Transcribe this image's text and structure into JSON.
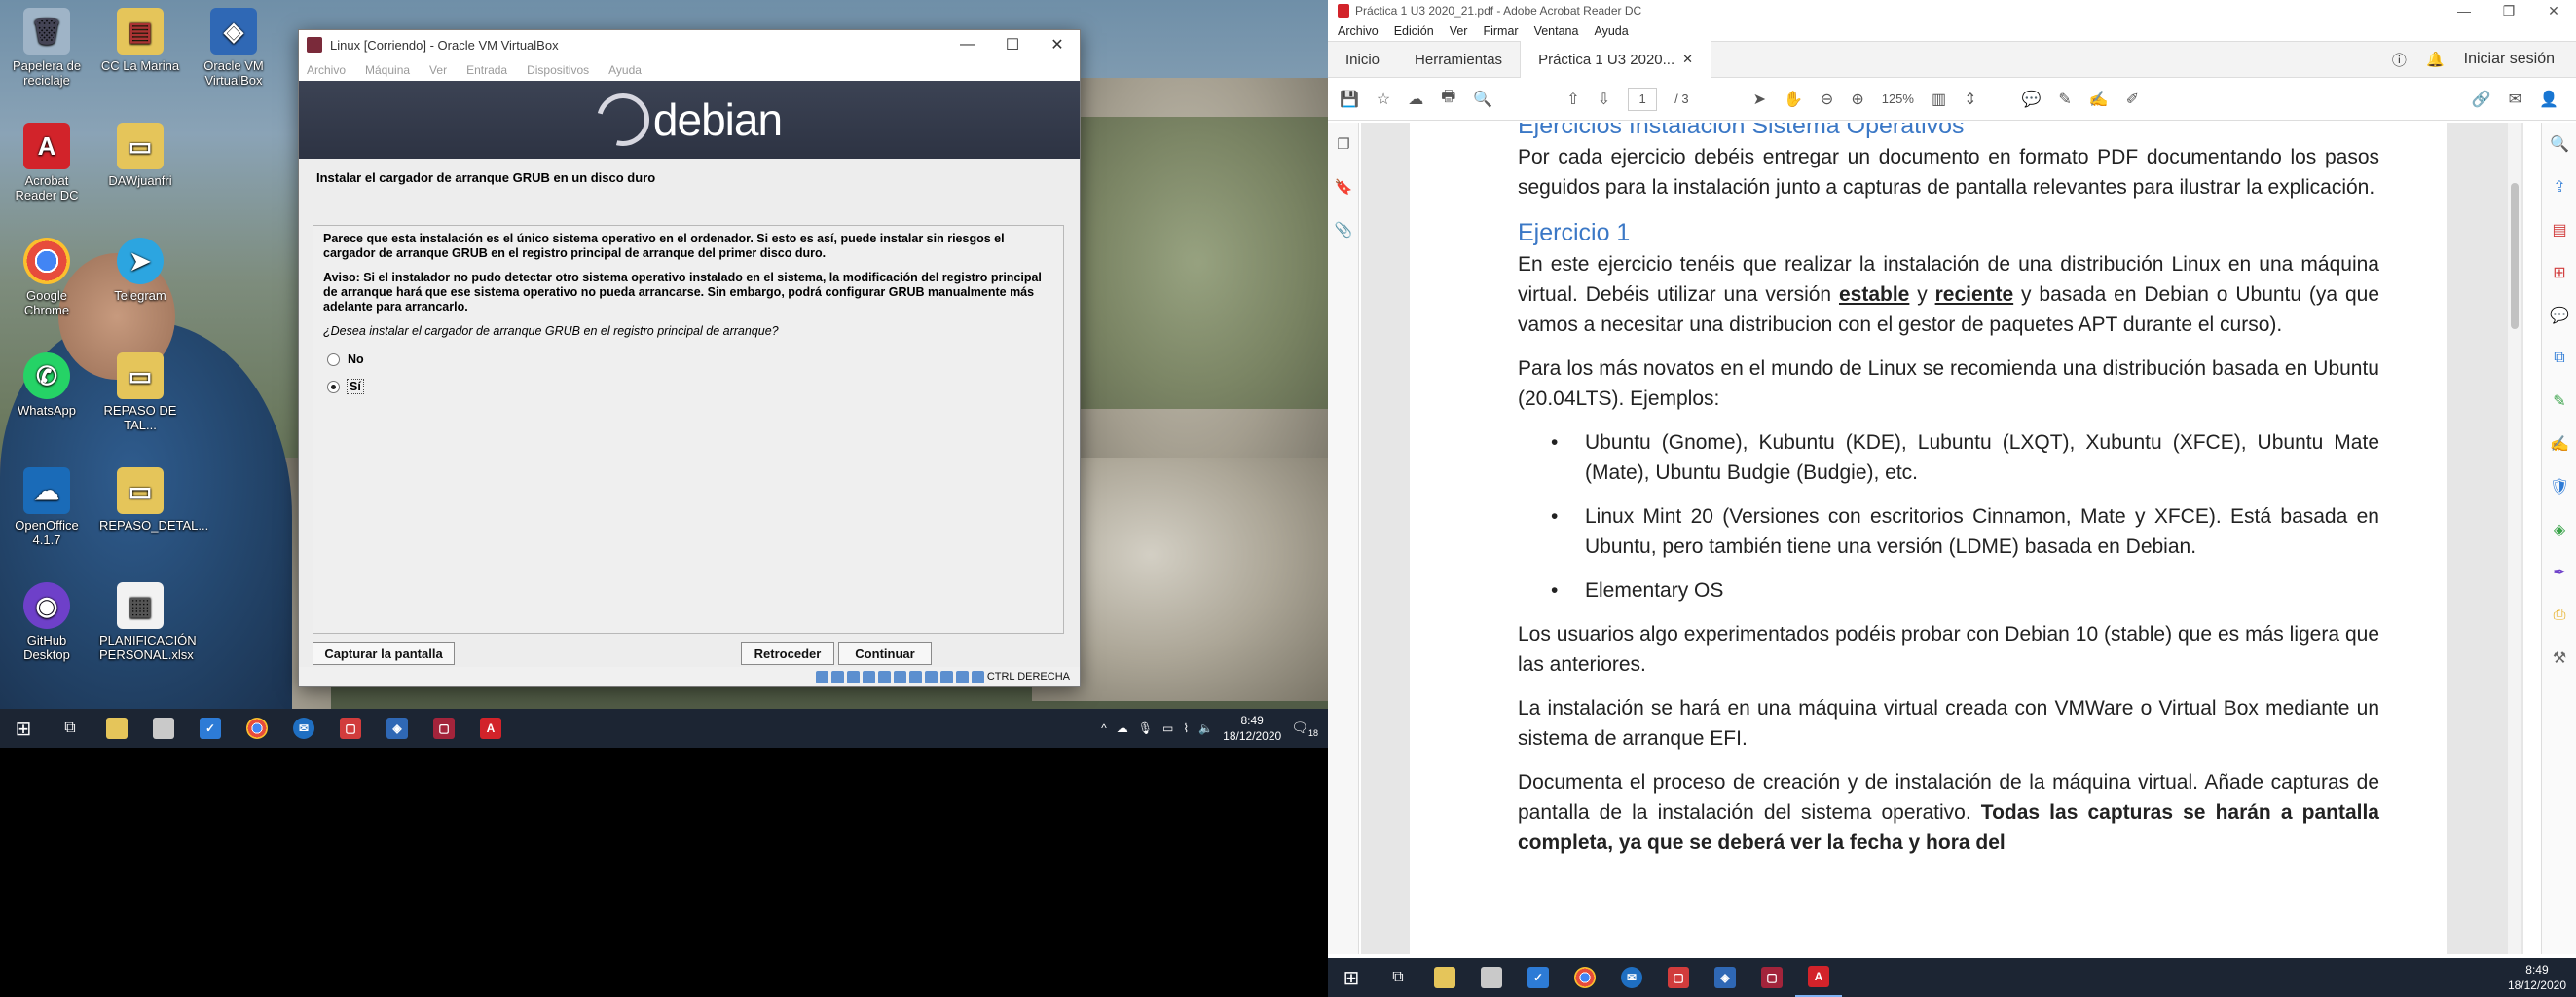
{
  "desktop": {
    "icons": [
      {
        "label": "Papelera de reciclaje",
        "icon": "recycle-bin-icon",
        "color": "#9fb4c7"
      },
      {
        "label": "CC La Marina",
        "icon": "folder-doc-icon",
        "color": "#e5c55a"
      },
      {
        "label": "Oracle VM VirtualBox",
        "icon": "virtualbox-icon",
        "color": "#2f68b5"
      },
      {
        "label": "Acrobat Reader DC",
        "icon": "acrobat-icon",
        "color": "#d2232a"
      },
      {
        "label": "DAWjuanfri",
        "icon": "folder-icon",
        "color": "#e5c55a"
      },
      {
        "label": "Google Chrome",
        "icon": "chrome-icon",
        "color": "#e74c3c"
      },
      {
        "label": "Telegram",
        "icon": "telegram-icon",
        "color": "#2ca5e0"
      },
      {
        "label": "WhatsApp",
        "icon": "whatsapp-icon",
        "color": "#25d366"
      },
      {
        "label": "REPASO DE TAL...",
        "icon": "folder-icon",
        "color": "#e5c55a"
      },
      {
        "label": "OpenOffice 4.1.7",
        "icon": "openoffice-icon",
        "color": "#1a6bb8"
      },
      {
        "label": "REPASO_DETAL...",
        "icon": "folder-icon",
        "color": "#e5c55a"
      },
      {
        "label": "GitHub Desktop",
        "icon": "github-icon",
        "color": "#6e40c9"
      },
      {
        "label": "PLANIFICACIÓN PERSONAL.xlsx",
        "icon": "document-icon",
        "color": "#f2f2f2"
      }
    ]
  },
  "vbox": {
    "title": "Linux [Corriendo] - Oracle VM VirtualBox",
    "menu": [
      "Archivo",
      "Máquina",
      "Ver",
      "Entrada",
      "Dispositivos",
      "Ayuda"
    ],
    "banner": "debian",
    "step_title": "Instalar el cargador de arranque GRUB en un disco duro",
    "para1": "Parece que esta instalación es el único sistema operativo en el ordenador. Si esto es así, puede instalar sin riesgos el cargador de arranque GRUB en el registro principal de arranque del primer disco duro.",
    "para2": "Aviso: Si el instalador no pudo detectar otro sistema operativo instalado en el sistema, la modificación del registro principal de arranque hará que ese sistema operativo no pueda arrancarse. Sin embargo, podrá configurar GRUB manualmente más adelante para arrancarlo.",
    "question": "¿Desea instalar el cargador de arranque GRUB en el registro principal de arranque?",
    "opt_no": "No",
    "opt_yes": "Sí",
    "btn_screenshot": "Capturar la pantalla",
    "btn_back": "Retroceder",
    "btn_continue": "Continuar",
    "host_key": "CTRL DERECHA"
  },
  "left_taskbar": {
    "time": "8:49",
    "date": "18/12/2020",
    "notif_count": "18"
  },
  "acrobat": {
    "title": "Práctica 1 U3 2020_21.pdf - Adobe Acrobat Reader DC",
    "menu": [
      "Archivo",
      "Edición",
      "Ver",
      "Firmar",
      "Ventana",
      "Ayuda"
    ],
    "tabs": [
      "Inicio",
      "Herramientas",
      "Práctica 1 U3 2020..."
    ],
    "signin": "Iniciar sesión",
    "page_current": "1",
    "page_total": "/ 3",
    "zoom": "125%",
    "doc": {
      "h_partial": "Ejercicios Instalación Sistema Operativos",
      "intro": "Por cada ejercicio debéis entregar un documento en formato PDF documentando los pasos seguidos para la instalación junto a capturas de pantalla relevantes para ilustrar la explicación.",
      "h1": "Ejercicio 1",
      "p1_a": "En este ejercicio tenéis que realizar la instalación de una distribución Linux en una máquina virtual. Debéis utilizar una versión ",
      "p1_b": "estable",
      "p1_c": " y ",
      "p1_d": "reciente",
      "p1_e": " y basada en Debian o Ubuntu (ya que vamos a necesitar una distribucion con el gestor de paquetes APT durante el curso).",
      "p2": "Para los más novatos en el mundo de Linux se recomienda una distribución basada en Ubuntu (20.04LTS). Ejemplos:",
      "bullets": [
        "Ubuntu (Gnome), Kubuntu (KDE), Lubuntu (LXQT), Xubuntu (XFCE), Ubuntu Mate (Mate), Ubuntu Budgie (Budgie), etc.",
        "Linux Mint 20 (Versiones con escritorios Cinnamon, Mate y XFCE). Está basada en Ubuntu, pero también tiene una versión (LDME) basada en Debian.",
        "Elementary OS"
      ],
      "p3": "Los usuarios algo experimentados podéis probar con Debian 10 (stable) que es más ligera que las anteriores.",
      "p4": "La instalación se hará en una máquina virtual creada con VMWare o Virtual Box mediante un sistema de arranque EFI.",
      "p5_a": "Documenta el proceso de creación y de instalación de la máquina virtual. Añade capturas de pantalla de la instalación del sistema operativo. ",
      "p5_b": "Todas las capturas se harán a pantalla completa, ya que se deberá ver la fecha y hora del"
    }
  },
  "right_taskbar": {
    "time": "8:49",
    "date": "18/12/2020"
  },
  "colors": {
    "taskbar": "#1c2533",
    "heading_blue": "#3b78c6",
    "acrobat_red": "#d2232a"
  }
}
